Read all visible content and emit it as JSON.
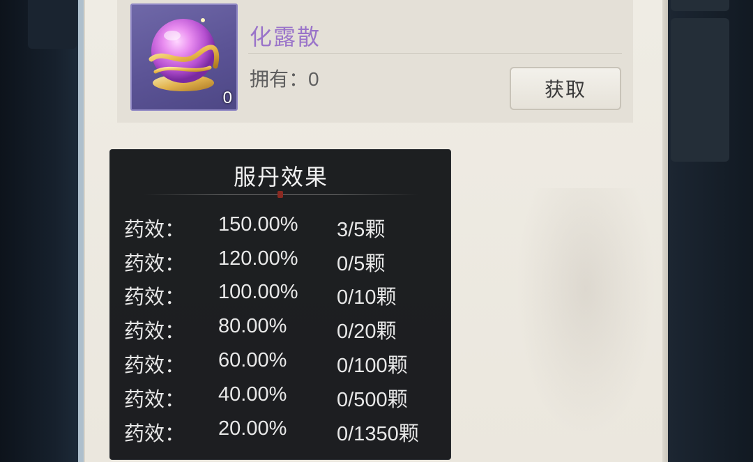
{
  "item": {
    "name": "化露散",
    "icon_count": "0",
    "owned_label": "拥有：",
    "owned_value": "0",
    "get_button_label": "获取"
  },
  "tooltip": {
    "title": "服丹效果",
    "rows": [
      {
        "label": "药效：",
        "value": "150.00%",
        "progress": "3/5",
        "unit": "颗"
      },
      {
        "label": "药效：",
        "value": "120.00%",
        "progress": "0/5",
        "unit": "颗"
      },
      {
        "label": "药效：",
        "value": "100.00%",
        "progress": "0/10",
        "unit": "颗"
      },
      {
        "label": "药效：",
        "value": "80.00%",
        "progress": "0/20",
        "unit": "颗"
      },
      {
        "label": "药效：",
        "value": "60.00%",
        "progress": "0/100",
        "unit": "颗"
      },
      {
        "label": "药效：",
        "value": "40.00%",
        "progress": "0/500",
        "unit": "颗"
      },
      {
        "label": "药效：",
        "value": "20.00%",
        "progress": "0/1350",
        "unit": "颗"
      }
    ]
  },
  "colors": {
    "item_name": "#9a74c9",
    "tooltip_bg": "#141619",
    "panel_bg": "#efece4"
  },
  "icons": {
    "item_icon": "purple-orb-icon"
  }
}
